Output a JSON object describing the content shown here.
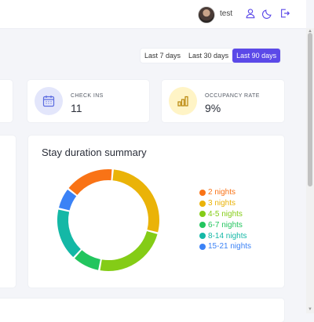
{
  "header": {
    "username": "test",
    "icons": [
      "user-icon",
      "moon-icon",
      "logout-icon"
    ]
  },
  "date_range": {
    "options": [
      "Last 7 days",
      "Last 30 days",
      "Last 90 days"
    ],
    "selected": "Last 90 days"
  },
  "stats": [
    {
      "label": "CHECK INS",
      "value": "11",
      "icon": "calendar-icon"
    },
    {
      "label": "OCCUPANCY RATE",
      "value": "9%",
      "icon": "bar-chart-icon"
    }
  ],
  "colors": {
    "accent": "#5b49e8",
    "check_ins_icon_bg": "#e3e6fb",
    "check_ins_icon": "#5b6be0",
    "occupancy_icon_bg": "#fff4c6",
    "occupancy_icon": "#b8860b"
  },
  "chart_data": {
    "type": "pie",
    "title": "Stay duration summary",
    "donut": true,
    "legend_position": "right",
    "categories": [
      "2 nights",
      "3 nights",
      "4-5 nights",
      "6-7 nights",
      "8-14 nights",
      "15-21 nights"
    ],
    "values": [
      16,
      28,
      24,
      9,
      17,
      7
    ],
    "colors": [
      "#f97316",
      "#eab308",
      "#84cc16",
      "#22c55e",
      "#14b8a6",
      "#3b82f6"
    ]
  }
}
